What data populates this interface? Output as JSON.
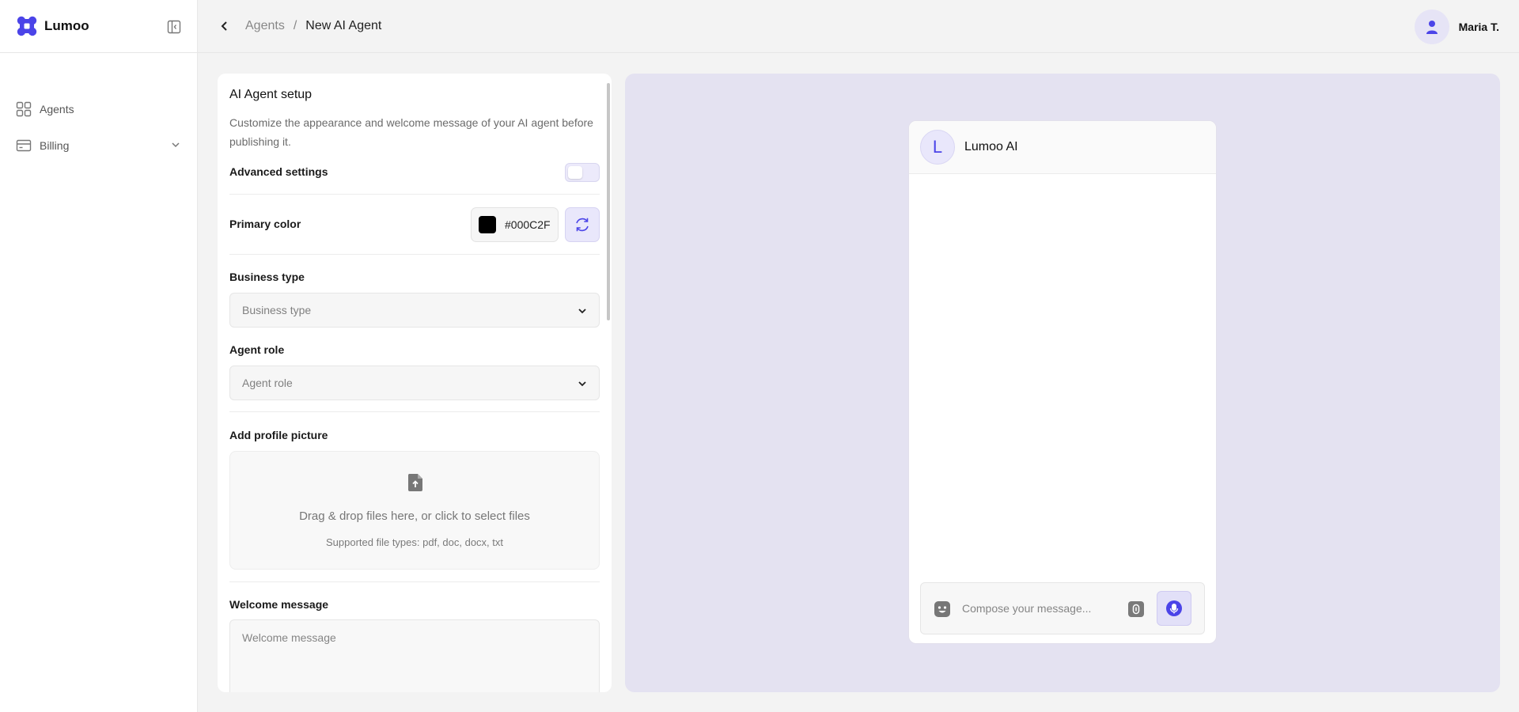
{
  "app": {
    "brand": "Lumoo",
    "accent": "#4B44E8"
  },
  "sidebar": {
    "items": [
      {
        "label": "Agents",
        "icon": "grid-icon"
      },
      {
        "label": "Billing",
        "icon": "card-icon"
      }
    ]
  },
  "header": {
    "breadcrumb": [
      "Agents",
      "New AI Agent"
    ],
    "separator": "/",
    "user_name": "Maria T."
  },
  "setup": {
    "title": "AI Agent setup",
    "description": "Customize the appearance and welcome message of your AI agent before publishing it.",
    "advanced_label": "Advanced settings",
    "advanced_enabled": false,
    "primary_color_label": "Primary color",
    "primary_color_value": "#000C2F",
    "business_type_label": "Business type",
    "business_type_placeholder": "Business type",
    "agent_role_label": "Agent role",
    "agent_role_placeholder": "Agent role",
    "profile_label": "Add profile picture",
    "dropzone_text": "Drag & drop files here, or click to select files",
    "dropzone_types": "Supported file types: pdf, doc, docx, txt",
    "welcome_label": "Welcome message",
    "welcome_placeholder": "Welcome message"
  },
  "preview": {
    "avatar_letter": "L",
    "title": "Lumoo AI",
    "compose_placeholder": "Compose your message..."
  }
}
